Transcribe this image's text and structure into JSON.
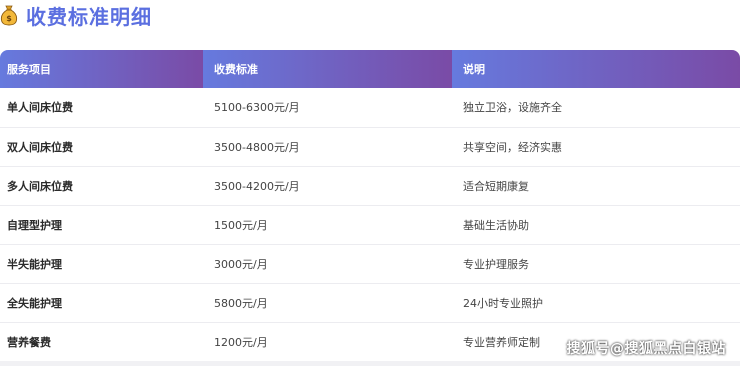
{
  "title": "收费标准明细",
  "title_icon": "money-bag-icon",
  "colors": {
    "title": "#5b6fe0",
    "header_gradient_start": "#667ade",
    "header_gradient_end": "#7a4ba6"
  },
  "table": {
    "headers": [
      "服务项目",
      "收费标准",
      "说明"
    ],
    "rows": [
      [
        "单人间床位费",
        "5100-6300元/月",
        "独立卫浴，设施齐全"
      ],
      [
        "双人间床位费",
        "3500-4800元/月",
        "共享空间，经济实惠"
      ],
      [
        "多人间床位费",
        "3500-4200元/月",
        "适合短期康复"
      ],
      [
        "自理型护理",
        "1500元/月",
        "基础生活协助"
      ],
      [
        "半失能护理",
        "3000元/月",
        "专业护理服务"
      ],
      [
        "全失能护理",
        "5800元/月",
        "24小时专业照护"
      ],
      [
        "营养餐费",
        "1200元/月",
        "专业营养师定制"
      ]
    ]
  },
  "watermark": "搜狐号@搜狐黑点白银站"
}
